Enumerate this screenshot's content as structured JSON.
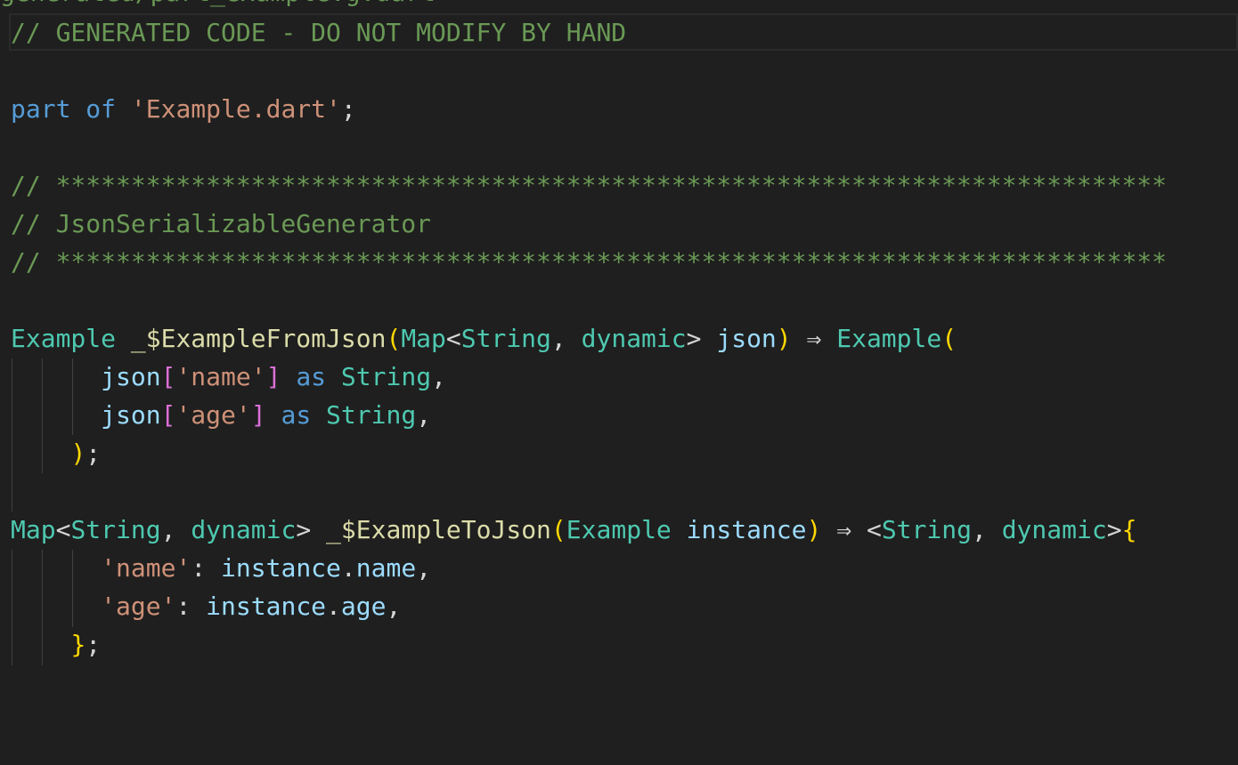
{
  "editor": {
    "colors": {
      "background": "#1f1f1f",
      "comment": "#6a9955",
      "keyword": "#569cd6",
      "string": "#ce9178",
      "type": "#4ec9b0",
      "function": "#dcdcaa",
      "variable": "#9cdcfe",
      "punctuation": "#d4d4d4",
      "bracket_level1": "#ffd700",
      "bracket_level2": "#da70d6"
    },
    "top_cut_text": "generated/part_example.g.dart",
    "lines": [
      {
        "tokens": [
          {
            "t": "// GENERATED CODE - DO NOT MODIFY BY HAND",
            "c": "c"
          }
        ]
      },
      {
        "tokens": []
      },
      {
        "tokens": [
          {
            "t": "part",
            "c": "kw"
          },
          {
            "t": " ",
            "c": "pu"
          },
          {
            "t": "of",
            "c": "kw"
          },
          {
            "t": " ",
            "c": "pu"
          },
          {
            "t": "'Example.dart'",
            "c": "st"
          },
          {
            "t": ";",
            "c": "pu"
          }
        ]
      },
      {
        "tokens": []
      },
      {
        "tokens": [
          {
            "t": "// **************************************************************************",
            "c": "c"
          }
        ]
      },
      {
        "tokens": [
          {
            "t": "// JsonSerializableGenerator",
            "c": "c"
          }
        ]
      },
      {
        "tokens": [
          {
            "t": "// **************************************************************************",
            "c": "c"
          }
        ]
      },
      {
        "tokens": []
      },
      {
        "tokens": [
          {
            "t": "Example",
            "c": "ty"
          },
          {
            "t": " ",
            "c": "pu"
          },
          {
            "t": "_$ExampleFromJson",
            "c": "fn"
          },
          {
            "t": "(",
            "c": "b1"
          },
          {
            "t": "Map",
            "c": "ty"
          },
          {
            "t": "<",
            "c": "pu"
          },
          {
            "t": "String",
            "c": "ty"
          },
          {
            "t": ", ",
            "c": "pu"
          },
          {
            "t": "dynamic",
            "c": "ty"
          },
          {
            "t": "> ",
            "c": "pu"
          },
          {
            "t": "json",
            "c": "va"
          },
          {
            "t": ")",
            "c": "b1"
          },
          {
            "t": " ⇒ ",
            "c": "pu"
          },
          {
            "t": "Example",
            "c": "ty"
          },
          {
            "t": "(",
            "c": "b1"
          }
        ]
      },
      {
        "tokens": [
          {
            "t": "      ",
            "c": "pu"
          },
          {
            "t": "json",
            "c": "va"
          },
          {
            "t": "[",
            "c": "b2"
          },
          {
            "t": "'name'",
            "c": "st"
          },
          {
            "t": "]",
            "c": "b2"
          },
          {
            "t": " ",
            "c": "pu"
          },
          {
            "t": "as",
            "c": "kw"
          },
          {
            "t": " ",
            "c": "pu"
          },
          {
            "t": "String",
            "c": "ty"
          },
          {
            "t": ",",
            "c": "pu"
          }
        ]
      },
      {
        "tokens": [
          {
            "t": "      ",
            "c": "pu"
          },
          {
            "t": "json",
            "c": "va"
          },
          {
            "t": "[",
            "c": "b2"
          },
          {
            "t": "'age'",
            "c": "st"
          },
          {
            "t": "]",
            "c": "b2"
          },
          {
            "t": " ",
            "c": "pu"
          },
          {
            "t": "as",
            "c": "kw"
          },
          {
            "t": " ",
            "c": "pu"
          },
          {
            "t": "String",
            "c": "ty"
          },
          {
            "t": ",",
            "c": "pu"
          }
        ]
      },
      {
        "tokens": [
          {
            "t": "    ",
            "c": "pu"
          },
          {
            "t": ")",
            "c": "b1"
          },
          {
            "t": ";",
            "c": "pu"
          }
        ]
      },
      {
        "tokens": []
      },
      {
        "tokens": [
          {
            "t": "Map",
            "c": "ty"
          },
          {
            "t": "<",
            "c": "pu"
          },
          {
            "t": "String",
            "c": "ty"
          },
          {
            "t": ", ",
            "c": "pu"
          },
          {
            "t": "dynamic",
            "c": "ty"
          },
          {
            "t": "> ",
            "c": "pu"
          },
          {
            "t": "_$ExampleToJson",
            "c": "fn"
          },
          {
            "t": "(",
            "c": "b1"
          },
          {
            "t": "Example",
            "c": "ty"
          },
          {
            "t": " ",
            "c": "pu"
          },
          {
            "t": "instance",
            "c": "va"
          },
          {
            "t": ")",
            "c": "b1"
          },
          {
            "t": " ⇒ ",
            "c": "pu"
          },
          {
            "t": "<",
            "c": "pu"
          },
          {
            "t": "String",
            "c": "ty"
          },
          {
            "t": ", ",
            "c": "pu"
          },
          {
            "t": "dynamic",
            "c": "ty"
          },
          {
            "t": ">",
            "c": "pu"
          },
          {
            "t": "{",
            "c": "b1"
          }
        ]
      },
      {
        "tokens": [
          {
            "t": "      ",
            "c": "pu"
          },
          {
            "t": "'name'",
            "c": "st"
          },
          {
            "t": ": ",
            "c": "pu"
          },
          {
            "t": "instance",
            "c": "va"
          },
          {
            "t": ".",
            "c": "pu"
          },
          {
            "t": "name",
            "c": "va"
          },
          {
            "t": ",",
            "c": "pu"
          }
        ]
      },
      {
        "tokens": [
          {
            "t": "      ",
            "c": "pu"
          },
          {
            "t": "'age'",
            "c": "st"
          },
          {
            "t": ": ",
            "c": "pu"
          },
          {
            "t": "instance",
            "c": "va"
          },
          {
            "t": ".",
            "c": "pu"
          },
          {
            "t": "age",
            "c": "va"
          },
          {
            "t": ",",
            "c": "pu"
          }
        ]
      },
      {
        "tokens": [
          {
            "t": "    ",
            "c": "pu"
          },
          {
            "t": "}",
            "c": "b1"
          },
          {
            "t": ";",
            "c": "pu"
          }
        ]
      }
    ]
  }
}
